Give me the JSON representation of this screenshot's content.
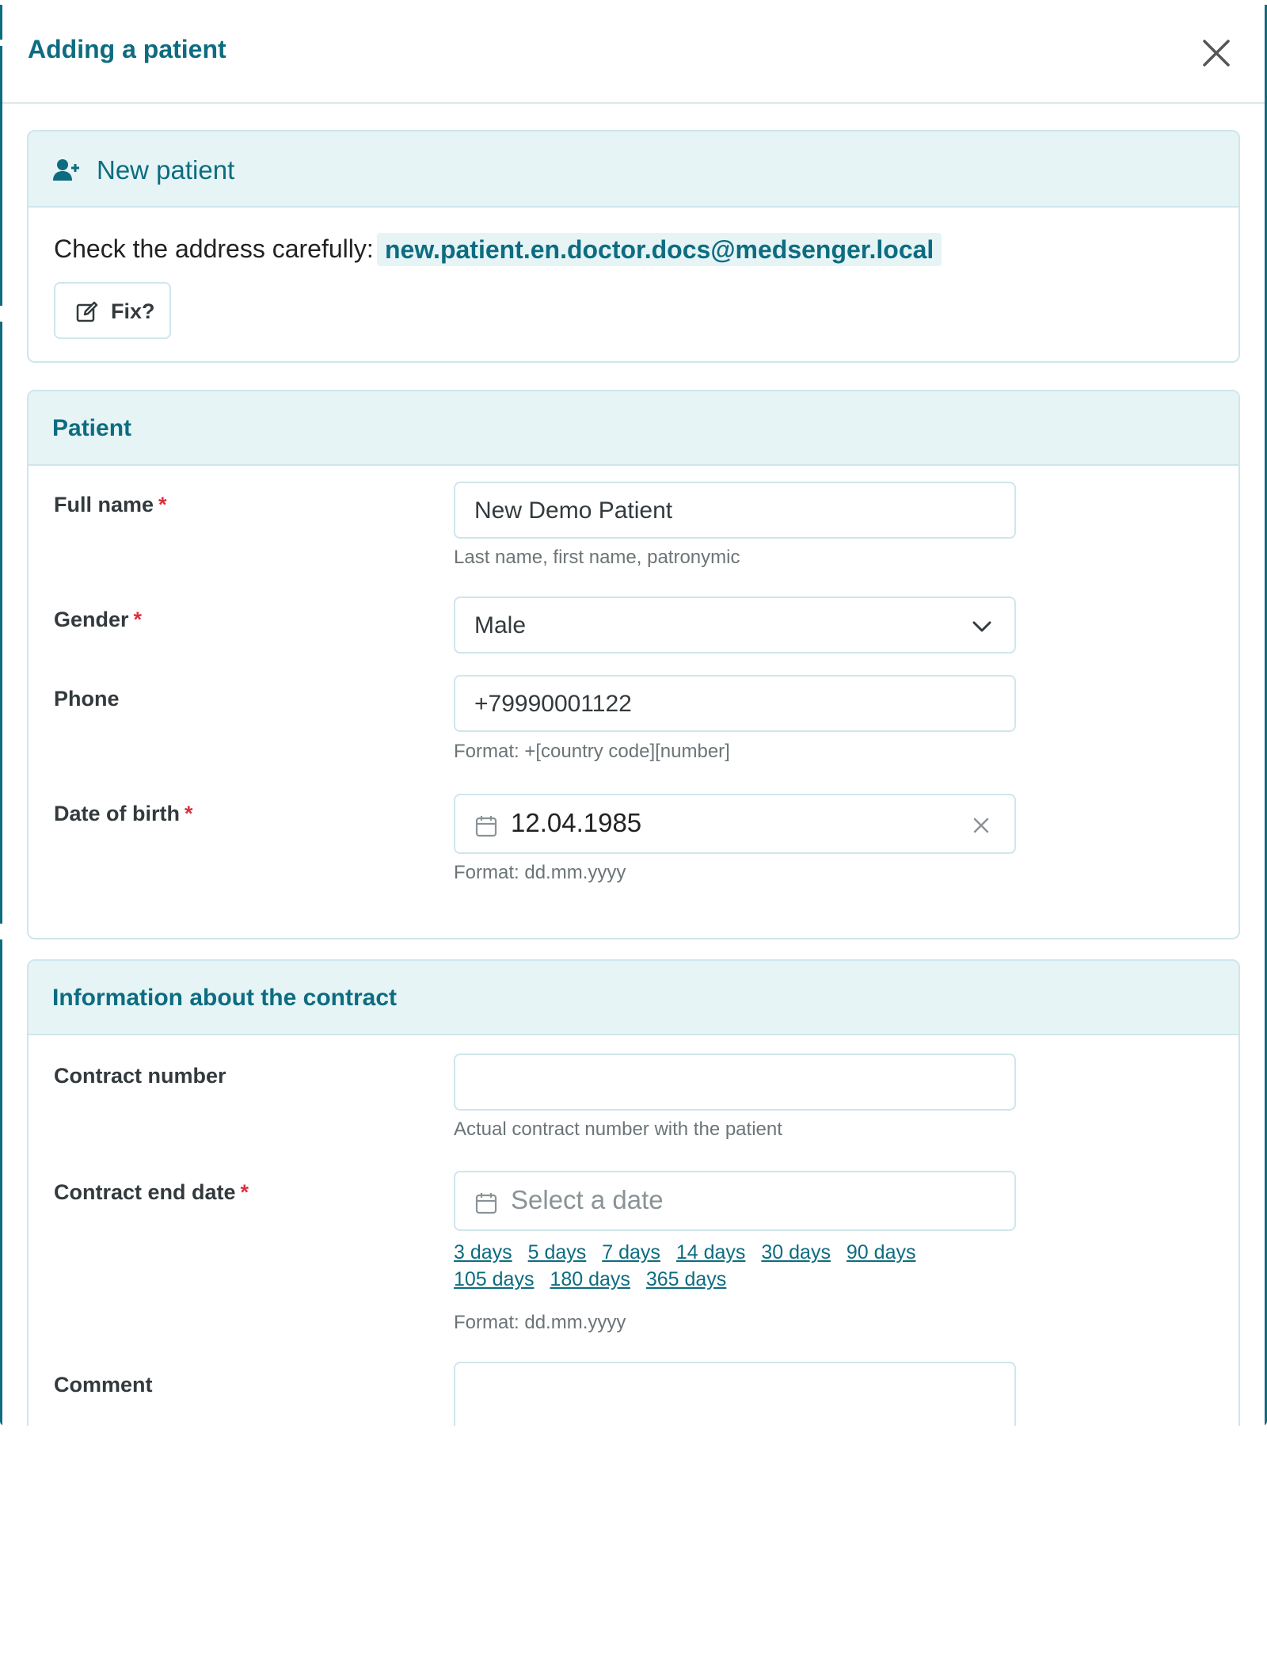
{
  "modal": {
    "title": "Adding a patient",
    "close_icon": "close-icon"
  },
  "new_patient": {
    "icon": "user-plus-icon",
    "title": "New patient",
    "check_text": "Check the address carefully:",
    "email": "new.patient.en.doctor.docs@medsenger.local",
    "fix_icon": "edit-icon",
    "fix_label": "Fix?"
  },
  "patient": {
    "title": "Patient",
    "full_name": {
      "label": "Full name",
      "required_mark": "*",
      "value": "New Demo Patient",
      "hint": "Last name, first name, patronymic"
    },
    "gender": {
      "label": "Gender",
      "required_mark": "*",
      "value": "Male"
    },
    "phone": {
      "label": "Phone",
      "value": "+79990001122",
      "hint": "Format: +[country code][number]"
    },
    "dob": {
      "label": "Date of birth",
      "required_mark": "*",
      "value": "12.04.1985",
      "hint": "Format: dd.mm.yyyy"
    }
  },
  "contract": {
    "title": "Information about the contract",
    "number": {
      "label": "Contract number",
      "value": "",
      "hint": "Actual contract number with the patient"
    },
    "end_date": {
      "label": "Contract end date",
      "required_mark": "*",
      "placeholder": "Select a date",
      "quick_links": [
        "3 days",
        "5 days",
        "7 days",
        "14 days",
        "30 days",
        "90 days",
        "105 days",
        "180 days",
        "365 days"
      ],
      "hint": "Format: dd.mm.yyyy"
    },
    "comment": {
      "label": "Comment",
      "value": ""
    }
  },
  "colors": {
    "accent": "#0d6c80",
    "panel_header_bg": "#e6f4f6",
    "border": "#cfe6ec",
    "required": "#d9303f"
  }
}
